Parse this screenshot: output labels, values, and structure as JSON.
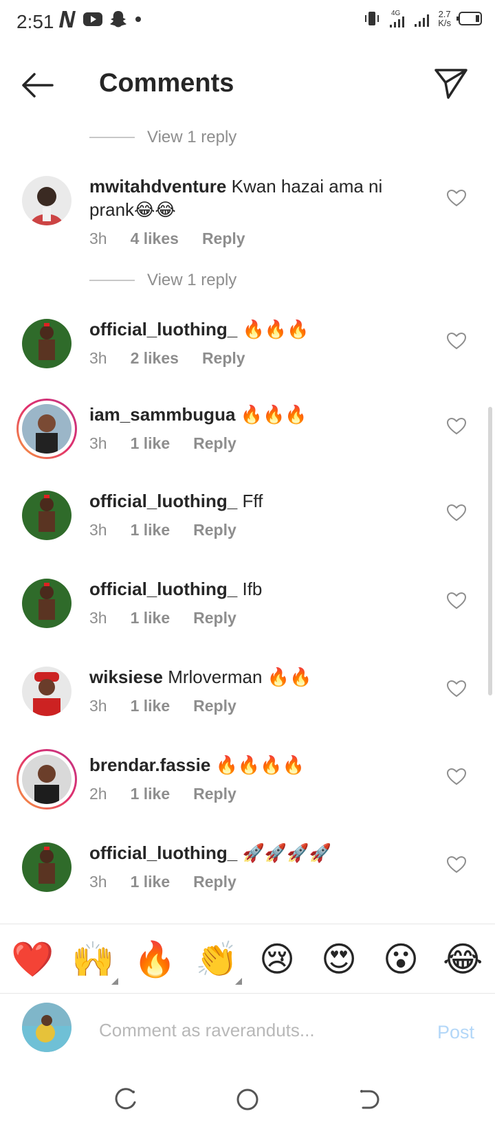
{
  "status_bar": {
    "time": "2:51",
    "icons": [
      "netflix-icon",
      "youtube-icon",
      "snapchat-icon",
      "dot-icon",
      "vibrate-icon",
      "4g-signal-icon",
      "signal-icon",
      "battery-icon"
    ],
    "network": "4G",
    "speed_value": "2.7",
    "speed_unit": "K/s"
  },
  "header": {
    "title": "Comments"
  },
  "comments": [
    {
      "username": "mwitahdventure",
      "text": "Kwan hazai ama ni prank😂😂",
      "time": "3h",
      "likes": "4 likes",
      "reply_label": "Reply",
      "avatar_ring": false
    },
    {
      "username": "official_luothing_",
      "text": "🔥🔥🔥",
      "time": "3h",
      "likes": "2 likes",
      "reply_label": "Reply",
      "avatar_ring": false
    },
    {
      "username": "iam_sammbugua",
      "text": "🔥🔥🔥",
      "time": "3h",
      "likes": "1 like",
      "reply_label": "Reply",
      "avatar_ring": true
    },
    {
      "username": "official_luothing_",
      "text": "Fff",
      "time": "3h",
      "likes": "1 like",
      "reply_label": "Reply",
      "avatar_ring": false
    },
    {
      "username": "official_luothing_",
      "text": "Ifb",
      "time": "3h",
      "likes": "1 like",
      "reply_label": "Reply",
      "avatar_ring": false
    },
    {
      "username": "wiksiese",
      "text": "Mrloverman 🔥🔥",
      "time": "3h",
      "likes": "1 like",
      "reply_label": "Reply",
      "avatar_ring": false
    },
    {
      "username": "brendar.fassie",
      "text": "🔥🔥🔥🔥",
      "time": "2h",
      "likes": "1 like",
      "reply_label": "Reply",
      "avatar_ring": true
    },
    {
      "username": "official_luothing_",
      "text": "🚀🚀🚀🚀",
      "time": "3h",
      "likes": "1 like",
      "reply_label": "Reply",
      "avatar_ring": false
    }
  ],
  "view_replies": [
    "View 1 reply",
    "View 1 reply"
  ],
  "reactions": [
    "❤️",
    "🙌",
    "🔥",
    "👏",
    "😢",
    "😍",
    "😮",
    "😂"
  ],
  "composer": {
    "placeholder": "Comment as raveranduts...",
    "post_label": "Post"
  },
  "colors": {
    "accent_blue_disabled": "#b3d7f8",
    "meta_gray": "#8e8e8e",
    "ring_gradient": [
      "#f9a23c",
      "#e1306c",
      "#c13584"
    ]
  }
}
